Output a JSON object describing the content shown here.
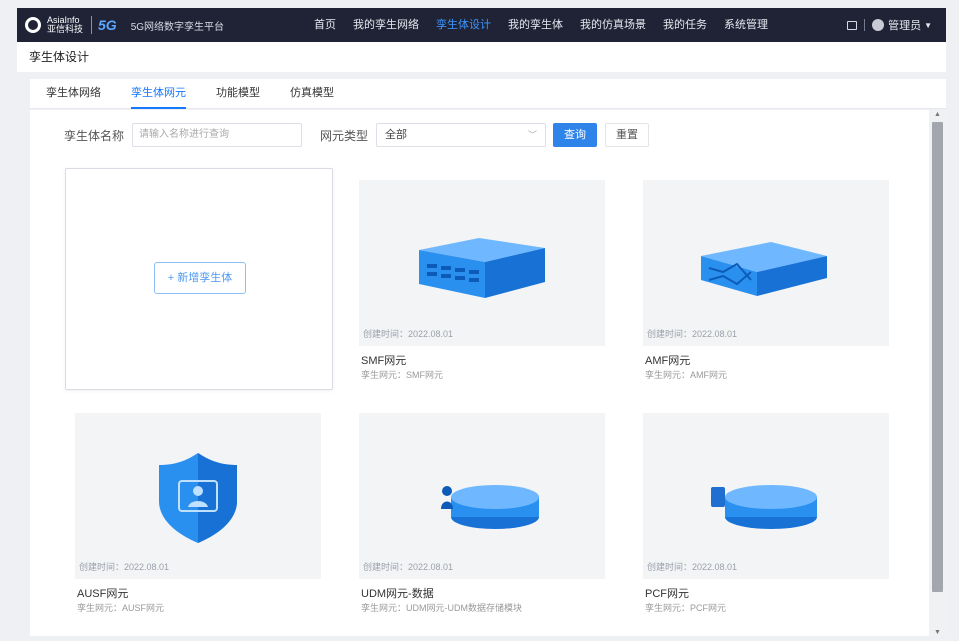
{
  "brand": {
    "name_line1": "AsiaInfo",
    "name_line2": "亚信科技",
    "badge": "5G",
    "subtitle": "5G网络数字孪生平台"
  },
  "topnav": {
    "items": [
      {
        "label": "首页",
        "active": false
      },
      {
        "label": "我的孪生网络",
        "active": false
      },
      {
        "label": "孪生体设计",
        "active": true
      },
      {
        "label": "我的孪生体",
        "active": false
      },
      {
        "label": "我的仿真场景",
        "active": false
      },
      {
        "label": "我的任务",
        "active": false
      },
      {
        "label": "系统管理",
        "active": false
      }
    ],
    "user_name": "管理员"
  },
  "page_title": "孪生体设计",
  "tabs": [
    {
      "label": "孪生体网络",
      "active": false
    },
    {
      "label": "孪生体网元",
      "active": true
    },
    {
      "label": "功能模型",
      "active": false
    },
    {
      "label": "仿真模型",
      "active": false
    }
  ],
  "filter": {
    "name_label": "孪生体名称",
    "name_placeholder": "请输入名称进行查询",
    "type_label": "网元类型",
    "type_value": "全部",
    "search_button": "查询",
    "reset_button": "重置"
  },
  "add_card": {
    "label": "+ 新增孪生体"
  },
  "cards": [
    {
      "name": "SMF网元",
      "date": "创建时间：2022.08.01",
      "sub": "孪生网元：SMF网元",
      "icon": "server-icon"
    },
    {
      "name": "AMF网元",
      "date": "创建时间：2022.08.01",
      "sub": "孪生网元：AMF网元",
      "icon": "switch-icon"
    },
    {
      "name": "AUSF网元",
      "date": "创建时间：2022.08.01",
      "sub": "孪生网元：AUSF网元",
      "icon": "shield-icon"
    },
    {
      "name": "UDM网元-数据",
      "date": "创建时间：2022.08.01",
      "sub": "孪生网元：UDM网元-UDM数据存储模块",
      "icon": "database-icon"
    },
    {
      "name": "PCF网元",
      "date": "创建时间：2022.08.01",
      "sub": "孪生网元：PCF网元",
      "icon": "policy-icon"
    }
  ],
  "colors": {
    "accent": "#1677ff",
    "topbar_bg": "#1f2335",
    "primary_button": "#2f84ea",
    "device_blue": "#2a90f0"
  }
}
